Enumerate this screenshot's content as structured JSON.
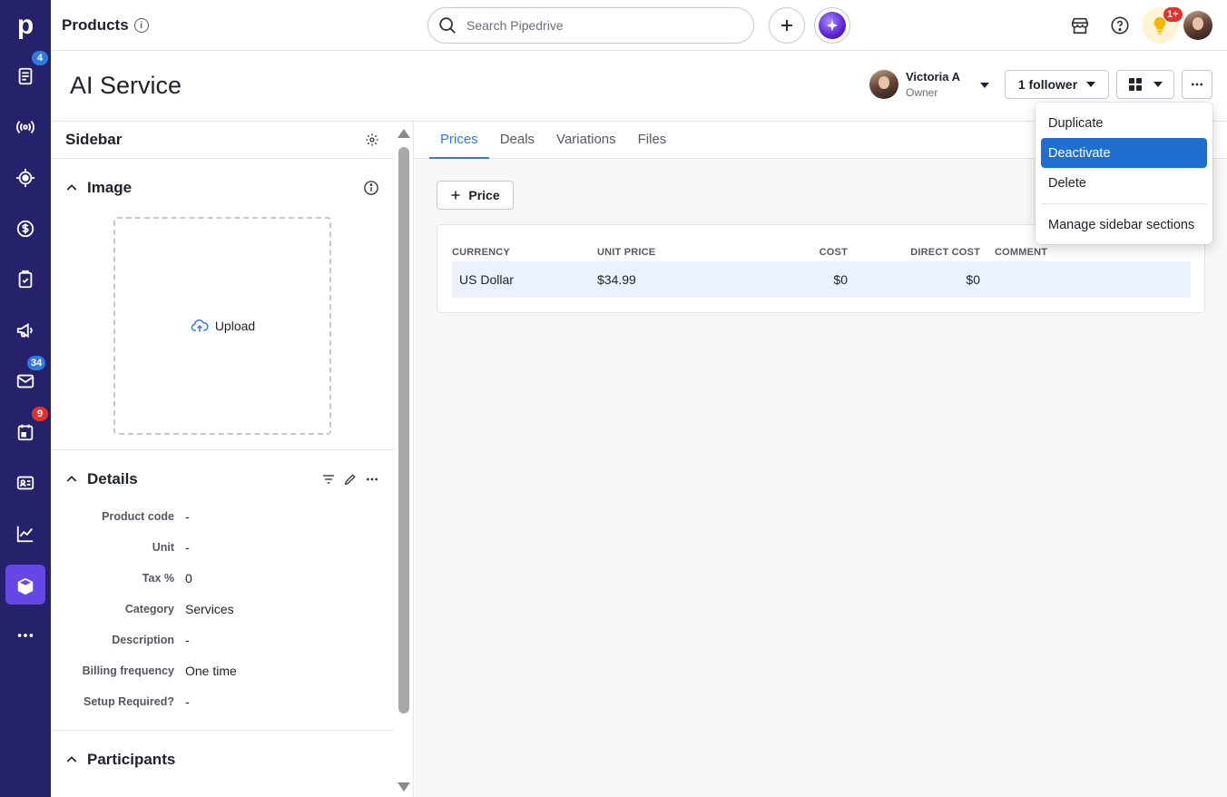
{
  "nav": {
    "logo": "p",
    "badges": {
      "leads": "4",
      "mail": "34",
      "activities": "9"
    }
  },
  "topbar": {
    "title": "Products",
    "info_glyph": "i",
    "search_placeholder": "Search Pipedrive",
    "notifications_badge": "1+"
  },
  "header": {
    "product_name": "AI Service",
    "owner_name": "Victoria A",
    "owner_role": "Owner",
    "follower_label": "1 follower"
  },
  "sidebar": {
    "title": "Sidebar",
    "image_section": "Image",
    "upload_label": "Upload",
    "details_section": "Details",
    "participants_section": "Participants",
    "details": [
      {
        "label": "Product code",
        "value": "-"
      },
      {
        "label": "Unit",
        "value": "-"
      },
      {
        "label": "Tax %",
        "value": "0"
      },
      {
        "label": "Category",
        "value": "Services"
      },
      {
        "label": "Description",
        "value": "-"
      },
      {
        "label": "Billing frequency",
        "value": "One time"
      },
      {
        "label": "Setup Required?",
        "value": "-"
      }
    ]
  },
  "main": {
    "tabs": [
      "Prices",
      "Deals",
      "Variations",
      "Files"
    ],
    "active_tab": "Prices",
    "add_price_label": "Price",
    "table": {
      "headers": [
        "CURRENCY",
        "UNIT PRICE",
        "COST",
        "DIRECT COST",
        "COMMENT"
      ],
      "rows": [
        {
          "currency": "US Dollar",
          "unit_price": "$34.99",
          "cost": "$0",
          "direct_cost": "$0",
          "comment": ""
        }
      ]
    }
  },
  "menu": {
    "items": [
      "Duplicate",
      "Deactivate",
      "Delete",
      "Manage sidebar sections"
    ],
    "highlighted": "Deactivate"
  },
  "colors": {
    "nav_bg": "#26216b",
    "nav_active": "#6447e6",
    "accent": "#317ae2",
    "menu_highlight": "#1f6fd1",
    "row_highlight": "#ebf2fd"
  }
}
